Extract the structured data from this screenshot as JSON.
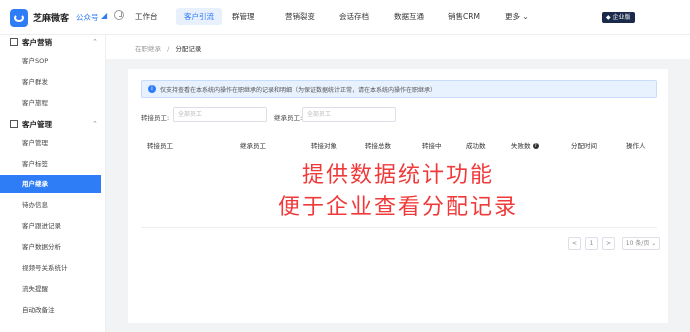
{
  "header": {
    "brand": "芝麻微客",
    "gzh": "公众号",
    "gzh_arrow": "◢",
    "nav": [
      "工作台",
      "客户引流",
      "群管理",
      "营销裂变",
      "会话存档",
      "数据互通",
      "销售CRM",
      "更多 ⌄"
    ],
    "active_nav": "客户引流",
    "vip": "◆ 企业版"
  },
  "sidebar": {
    "group1": "客户营销",
    "group1_items": [
      "客户SOP",
      "客户群发",
      "客户旅程"
    ],
    "group2": "客户管理",
    "group2_items": [
      "客户管理",
      "客户标签",
      "用户继承",
      "待办信息",
      "客户跟进记录",
      "客户数据分析",
      "视频号关系统计",
      "流失提醒",
      "自动改备注"
    ],
    "active_item": "用户继承",
    "arrow": "⌃"
  },
  "breadcrumb": {
    "parent": "在职继承",
    "sep": "/",
    "current": "分配记录"
  },
  "alert": {
    "icon": "i",
    "text": "仅支持查看在本系统内操作在职继承的记录和明细（为保证数据统计正常，请在本系统内操作在职继承）"
  },
  "filters": {
    "transfer_label": "转接员工:",
    "transfer_placeholder": "全部员工",
    "receiver_label": "继承员工:",
    "receiver_placeholder": "全部员工"
  },
  "table": {
    "headers": [
      "转接员工",
      "继承员工",
      "转接对象",
      "转接总数",
      "转接中",
      "成功数",
      "失败数",
      "分配时间",
      "操作人"
    ]
  },
  "overlay": {
    "line1": "提供数据统计功能",
    "line2": "便于企业查看分配记录"
  },
  "pagination": {
    "prev": "<",
    "page": "1",
    "next": ">",
    "page_size": "10 条/页 ⌄"
  }
}
